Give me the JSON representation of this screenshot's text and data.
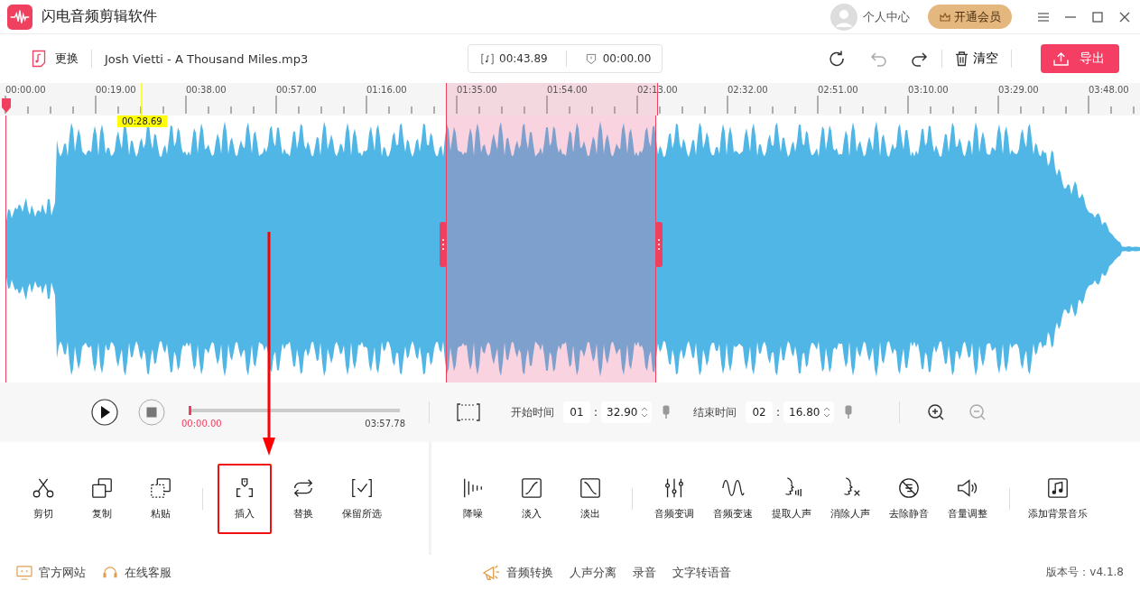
{
  "window": {
    "title": "闪电音频剪辑软件",
    "user_label": "个人中心",
    "vip_button": "开通会员"
  },
  "toolbar": {
    "replace_label": "更换",
    "file_name": "Josh Vietti - A Thousand Miles.mp3",
    "duration": "00:43.89",
    "position": "00:00.00",
    "history": [
      {
        "disabled": false
      },
      {
        "disabled": true
      },
      {
        "disabled": false
      }
    ],
    "clear_label": "清空",
    "export_label": "导出"
  },
  "ruler": {
    "labels": [
      "00:00.00",
      "00:19.00",
      "00:38.00",
      "00:57.00",
      "01:16.00",
      "01:35.00",
      "01:54.00",
      "02:13.00",
      "02:32.00",
      "02:51.00",
      "03:10.00",
      "03:29.00",
      "03:48.00"
    ]
  },
  "waveform": {
    "marker_time": "00:28.69"
  },
  "playback": {
    "current_time": "00:00.00",
    "total_time": "03:57.78",
    "level": 0.0,
    "start": {
      "label": "开始时间",
      "minutes": "01",
      "separator": ":",
      "seconds": "32.90"
    },
    "end": {
      "label": "结束时间",
      "minutes": "02",
      "separator": ":",
      "seconds": "16.80"
    },
    "zoom": [
      {
        "disabled": false
      },
      {
        "disabled": true
      }
    ]
  },
  "edit_panel": {
    "groups": [
      {
        "tools": [
          {
            "label": "剪切",
            "highlighted": false
          },
          {
            "label": "复制",
            "highlighted": false
          },
          {
            "label": "粘贴",
            "highlighted": false
          }
        ]
      },
      {
        "tools": [
          {
            "label": "插入",
            "highlighted": true
          },
          {
            "label": "替换",
            "highlighted": false
          },
          {
            "label": "保留所选",
            "highlighted": false
          }
        ]
      }
    ]
  },
  "effects_panel": {
    "groups": [
      {
        "tools": [
          {
            "label": "降噪",
            "highlighted": false
          },
          {
            "label": "淡入",
            "highlighted": false
          },
          {
            "label": "淡出",
            "highlighted": false
          }
        ]
      },
      {
        "tools": [
          {
            "label": "音频变调",
            "highlighted": false
          },
          {
            "label": "音频变速",
            "highlighted": false
          },
          {
            "label": "提取人声",
            "highlighted": false
          },
          {
            "label": "消除人声",
            "highlighted": false
          },
          {
            "label": "去除静音",
            "highlighted": false
          },
          {
            "label": "音量调整",
            "highlighted": false
          }
        ]
      },
      {
        "tools": [
          {
            "label": "添加背景音乐",
            "highlighted": false
          }
        ]
      }
    ]
  },
  "footer": {
    "left_links": [
      {
        "label": "官方网站"
      },
      {
        "label": "在线客服"
      }
    ],
    "center_links": [
      {
        "label": "音频转换"
      },
      {
        "label": "人声分离"
      },
      {
        "label": "录音"
      },
      {
        "label": "文字转语音"
      }
    ],
    "version": "版本号：v4.1.8"
  }
}
